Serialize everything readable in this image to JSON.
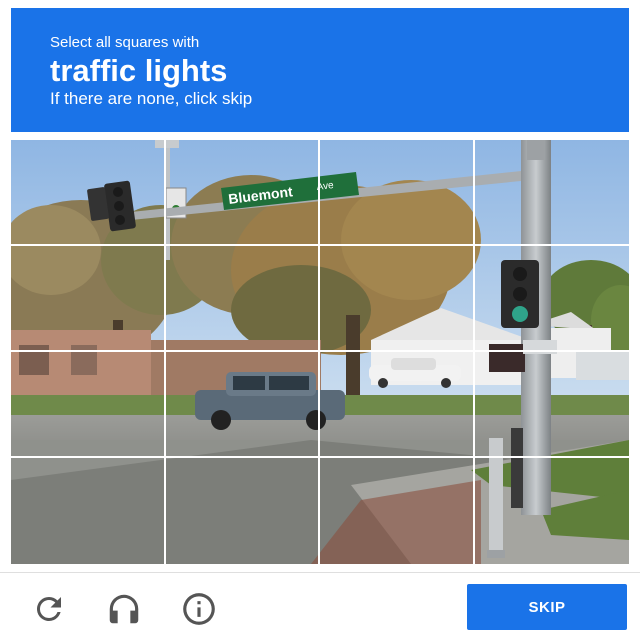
{
  "header": {
    "instruction": "Select all squares with",
    "target": "traffic lights",
    "hint": "If there are none, click skip"
  },
  "scene": {
    "street_sign": "Bluemont",
    "street_sign_suffix": "Ave"
  },
  "grid": {
    "rows": 4,
    "cols": 4
  },
  "footer": {
    "icons": [
      "reload-icon",
      "audio-headphones-icon",
      "info-icon"
    ],
    "skip_label": "SKIP"
  },
  "colors": {
    "accent": "#1a73e8",
    "icon": "#555555"
  }
}
